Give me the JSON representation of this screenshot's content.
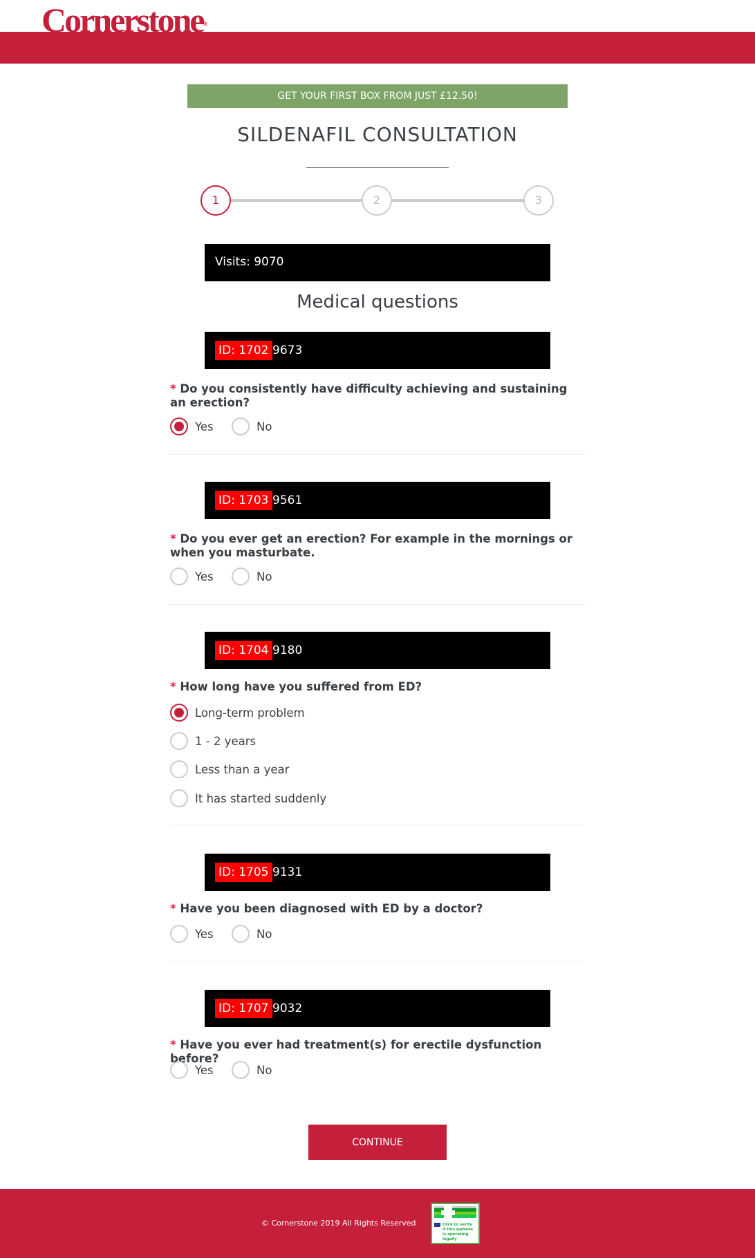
{
  "header": {
    "logo": "Cornerstone",
    "logo_mark": "®",
    "brand_color": "#c41f3b"
  },
  "promo": "GET YOUR FIRST BOX FROM JUST £12.50!",
  "title": "SILDENAFIL CONSULTATION",
  "steps": [
    "1",
    "2",
    "3"
  ],
  "current_step": 1,
  "visits": "Visits: 9070",
  "section": "Medical questions",
  "questions": [
    {
      "id": "ID: 1702",
      "num": "9673",
      "text": "Do you consistently have difficulty achieving and sustaining an erection?",
      "options": [
        "Yes",
        "No"
      ],
      "selected": 0
    },
    {
      "id": "ID: 1703",
      "num": "9561",
      "text": "Do you ever get an erection? For example in the mornings or when you masturbate.",
      "options": [
        "Yes",
        "No"
      ],
      "selected": null
    },
    {
      "id": "ID: 1704",
      "num": "9180",
      "text": "How long have you suffered from ED?",
      "options": [
        "Long-term problem",
        "1 - 2 years",
        "Less than a year",
        "It has started suddenly"
      ],
      "selected": 0
    },
    {
      "id": "ID: 1705",
      "num": "9131",
      "text": "Have you been diagnosed with ED by a doctor?",
      "options": [
        "Yes",
        "No"
      ],
      "selected": null
    },
    {
      "id": "ID: 1707",
      "num": "9032",
      "text": "Have you ever had treatment(s) for erectile dysfunction before?",
      "options": [
        "Yes",
        "No"
      ],
      "selected": null
    }
  ],
  "required_mark": "*",
  "continue": "CONTINUE",
  "footer": {
    "copyright": "© Cornerstone 2019 All Rights Reserved",
    "badge_text": "Click to verify if this website is operating legally"
  }
}
